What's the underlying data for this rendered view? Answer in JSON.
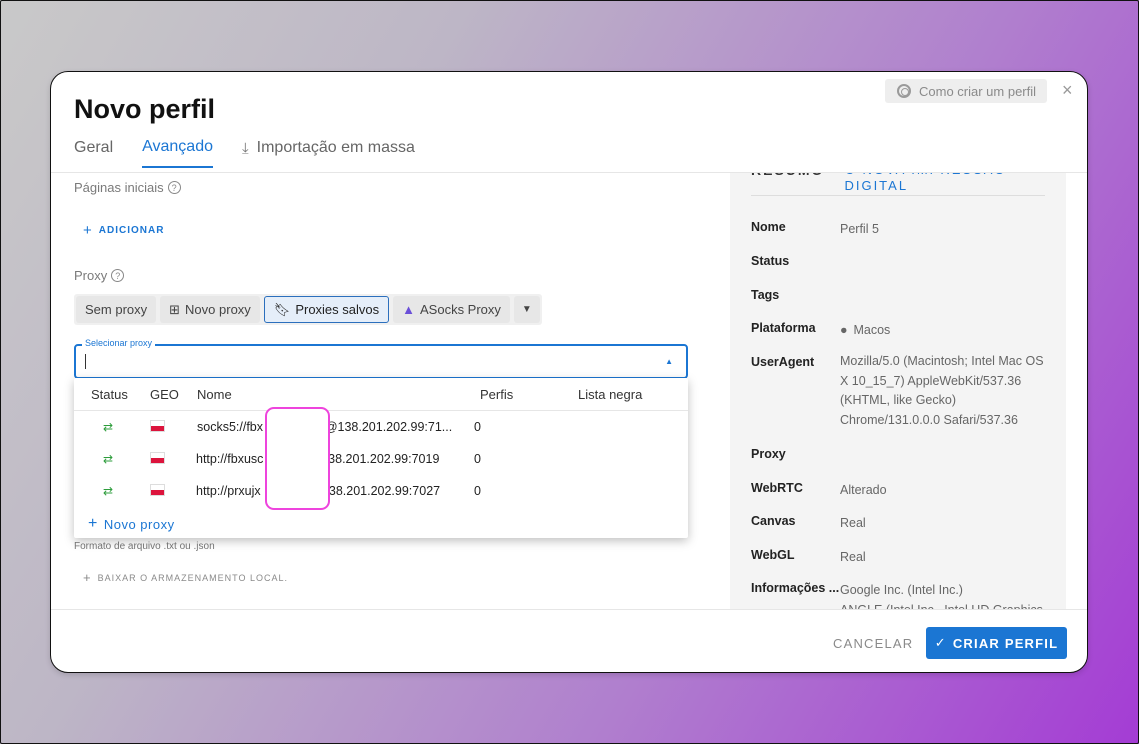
{
  "modal": {
    "title": "Novo perfil",
    "help_label": "Como criar um perfil",
    "close_icon": "×"
  },
  "tabs": [
    {
      "label": "Geral"
    },
    {
      "label": "Avançado"
    },
    {
      "label": "Importação em massa"
    }
  ],
  "left": {
    "start_pages_label": "Páginas iniciais",
    "add_label": "ADICIONAR",
    "proxy_label": "Proxy",
    "proxy_options": [
      {
        "label": "Sem proxy"
      },
      {
        "label": "Novo proxy"
      },
      {
        "label": "Proxies salvos"
      },
      {
        "label": "ASocks Proxy"
      }
    ],
    "select_legend": "Selecionar proxy",
    "file_hint": "Formato de arquivo .txt ou .json",
    "download_local": "BAIXAR O ARMAZENAMENTO LOCAL."
  },
  "dropdown": {
    "headers": {
      "status": "Status",
      "geo": "GEO",
      "nome": "Nome",
      "perfis": "Perfis",
      "lista_negra": "Lista negra"
    },
    "rows": [
      {
        "nome": "socks5://fbx            xnh@138.201.202.99:71...",
        "perfis": "0"
      },
      {
        "nome": "http://fbxusc             @138.201.202.99:7019",
        "perfis": "0"
      },
      {
        "nome": "http://prxujx             f@138.201.202.99:7027",
        "perfis": "0"
      }
    ],
    "new_proxy": "Novo proxy"
  },
  "summary": {
    "heading": "RESUMO",
    "new_fingerprint": "NOVA IMPRESSÃO DIGITAL",
    "rows": [
      {
        "key": "Nome",
        "value": "Perfil 5"
      },
      {
        "key": "Status",
        "value": ""
      },
      {
        "key": "Tags",
        "value": ""
      },
      {
        "key": "Plataforma",
        "value": "Macos"
      },
      {
        "key": "UserAgent",
        "value": "Mozilla/5.0 (Macintosh; Intel Mac OS X 10_15_7) AppleWebKit/537.36 (KHTML, like Gecko) Chrome/131.0.0.0 Safari/537.36"
      },
      {
        "key": "Proxy",
        "value": ""
      },
      {
        "key": "WebRTC",
        "value": "Alterado"
      },
      {
        "key": "Canvas",
        "value": "Real"
      },
      {
        "key": "WebGL",
        "value": "Real"
      },
      {
        "key": "Informações ...",
        "value": "Google Inc. (Intel Inc.)"
      },
      {
        "key": "",
        "value": "ANGLE (Intel Inc., Intel HD Graphics"
      }
    ]
  },
  "footer": {
    "cancel": "CANCELAR",
    "create": "CRIAR PERFIL"
  },
  "colors": {
    "accent": "#1b76d3",
    "status_green": "#2e9d3c",
    "redaction_border": "#ee44dd"
  }
}
